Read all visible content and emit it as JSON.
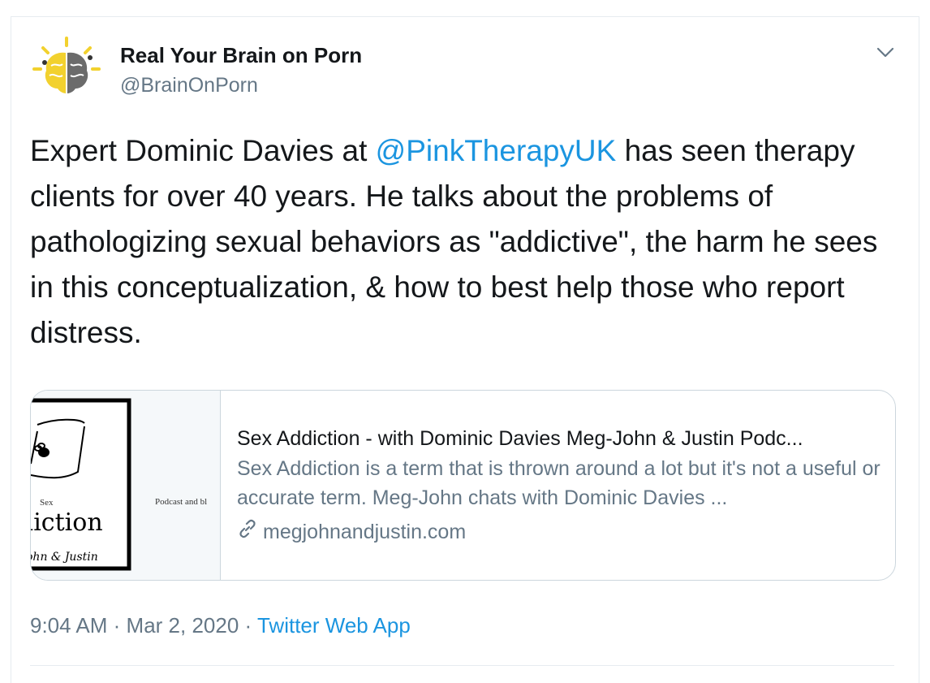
{
  "tweet": {
    "author_name": "Real Your Brain on Porn",
    "author_handle": "@BrainOnPorn",
    "text_before": "Expert Dominic Davies at ",
    "mention": "@PinkTherapyUK",
    "text_after": " has seen therapy clients for over 40 years. He talks about the problems of pathologizing sexual behaviors as \"addictive\", the harm he sees in this conceptualization, & how to best help those who report distress."
  },
  "link_card": {
    "title": "Sex Addiction - with Dominic Davies Meg-John & Justin Podc...",
    "description": "Sex Addiction is a term that is thrown around a lot but it's not a useful or accurate term. Meg-John chats with Dominic Davies ...",
    "url": "megjohnandjustin.com",
    "thumb_word_small": "Sex",
    "thumb_word_big": "diction",
    "thumb_names": "ohn & Justin",
    "thumb_side": "Podcast and bl"
  },
  "meta": {
    "time": "9:04 AM",
    "sep1": "·",
    "date": "Mar 2, 2020",
    "sep2": "·",
    "source": "Twitter Web App"
  },
  "colors": {
    "accent": "#1b95e0",
    "muted": "#657786",
    "border": "#ccd6dd"
  },
  "icons": [
    "brain-avatar-icon",
    "chevron-down-icon",
    "link-icon"
  ]
}
